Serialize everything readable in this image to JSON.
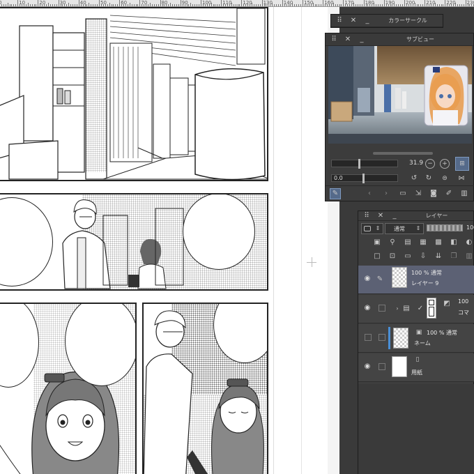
{
  "ruler": {
    "labels": [
      "0",
      "10",
      "20",
      "30",
      "40",
      "50",
      "60",
      "70",
      "80",
      "90",
      "100",
      "110",
      "120",
      "130",
      "140",
      "150",
      "160",
      "170",
      "180",
      "190",
      "200",
      "210",
      "220",
      "230"
    ]
  },
  "color_circle": {
    "title": "カラーサークル"
  },
  "sub_view": {
    "title": "サブビュー",
    "zoom_value": "31.9",
    "rotate_value": "0.0"
  },
  "layer_palette": {
    "title": "レイヤー",
    "blend_mode": "通常",
    "opacity_value": "100",
    "layers": [
      {
        "opacity_mode": "100 % 通常",
        "name": "レイヤー 9",
        "selected": true
      },
      {
        "opacity_mode": "100",
        "name": "コマ",
        "selected": false
      },
      {
        "opacity_mode": "100 % 通常",
        "name": "ネーム",
        "selected": false
      },
      {
        "opacity_mode": "",
        "name": "用紙",
        "selected": false
      }
    ]
  },
  "colors": {
    "panel_bg": "#434343",
    "selected_layer": "#5c6174",
    "canvas_bg": "#f4f4f4",
    "accent_blue": "#4a8fd6"
  }
}
